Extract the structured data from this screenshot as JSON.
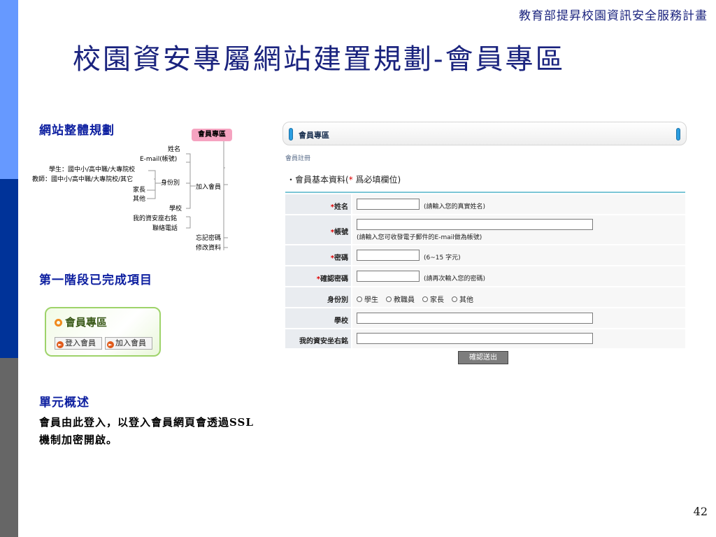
{
  "header": {
    "org": "教育部提昇校園資訊安全服務計畫",
    "title": "校園資安專屬網站建置規劃-會員專區"
  },
  "colors": {
    "strip_top": "#6699ff",
    "strip_mid": "#003399",
    "strip_bottom": "#666666",
    "title": "#1a237e",
    "heading": "#0d1fa0"
  },
  "sections": {
    "site_plan": "網站整體規劃",
    "phase_one": "第一階段已完成項目",
    "overview": "單元概述"
  },
  "summary_text": "會員由此登入，以登入會員網頁會透過SSL機制加密開啟。",
  "mindmap": {
    "root": "會員專區",
    "branches": {
      "join": "加入會員",
      "forgot": "忘記密碼",
      "edit": "修改資料"
    },
    "fields": {
      "name": "姓名",
      "email": "E-mail(帳號)",
      "identity": "身份別",
      "school": "學校",
      "motto": "我的資安座右銘",
      "phone": "聯絡電話"
    },
    "identity_items": {
      "student": "學生：國中小/高中職/大專院校",
      "teacher": "教師：國中小/高中職/大專院校/其它",
      "parent": "家長",
      "other": "其他"
    }
  },
  "member_box": {
    "title": "會員專區",
    "login": "登入會員",
    "join": "加入會員"
  },
  "form": {
    "title": "會員專區",
    "breadcrumb": "會員註冊",
    "section_prefix": "・會員基本資料(",
    "required_mark": "*",
    "section_suffix": " 爲必填欄位)",
    "fields": {
      "name": {
        "label": "姓名",
        "hint": "(請輸入您的真實姓名)"
      },
      "account": {
        "label": "帳號",
        "hint": "(請輸入您可收發電子郵件的E-mail做為帳號)"
      },
      "password": {
        "label": "密碼",
        "hint": "(6~15 字元)"
      },
      "confirm": {
        "label": "確認密碼",
        "hint": "(請再次輸入您的密碼)"
      },
      "identity": {
        "label": "身份別"
      },
      "school": {
        "label": "學校"
      },
      "motto": {
        "label": "我的資安坐右銘"
      }
    },
    "identity_options": [
      "學生",
      "教職員",
      "家長",
      "其他"
    ],
    "submit": "確認送出"
  },
  "page_number": "42"
}
